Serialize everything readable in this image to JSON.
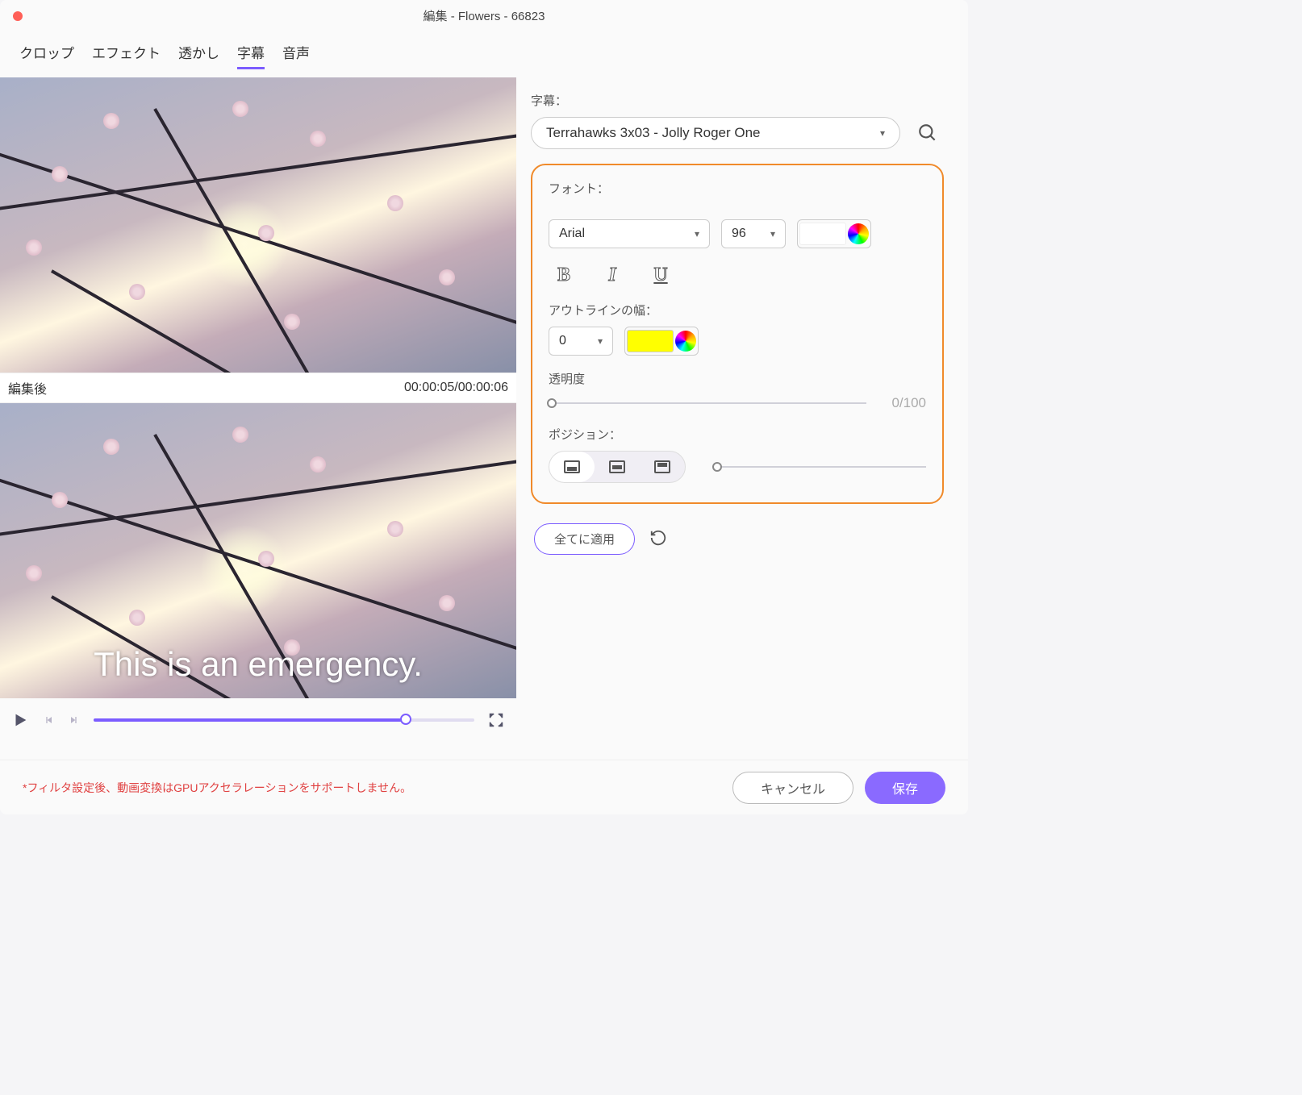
{
  "title": "編集 - Flowers - 66823",
  "tabs": {
    "crop": "クロップ",
    "effect": "エフェクト",
    "watermark": "透かし",
    "subtitle": "字幕",
    "audio": "音声"
  },
  "active_tab": "subtitle",
  "preview": {
    "after_label": "編集後",
    "time_current": "00:00:05",
    "time_total": "00:00:06",
    "subtitle_text": "This is an emergency."
  },
  "subtitle": {
    "label": "字幕：",
    "selected": "Terrahawks 3x03 - Jolly Roger One",
    "font_label": "フォント：",
    "font_family": "Arial",
    "font_size": "96",
    "font_color": "#ffffff",
    "outline_label": "アウトラインの幅：",
    "outline_width": "0",
    "outline_color": "#ffff00",
    "opacity_label": "透明度",
    "opacity_value": "0/100",
    "position_label": "ポジション：",
    "position": "bottom"
  },
  "actions": {
    "apply_all": "全てに適用"
  },
  "footer": {
    "warning": "*フィルタ設定後、動画変換はGPUアクセラレーションをサポートしません。",
    "cancel": "キャンセル",
    "save": "保存"
  }
}
